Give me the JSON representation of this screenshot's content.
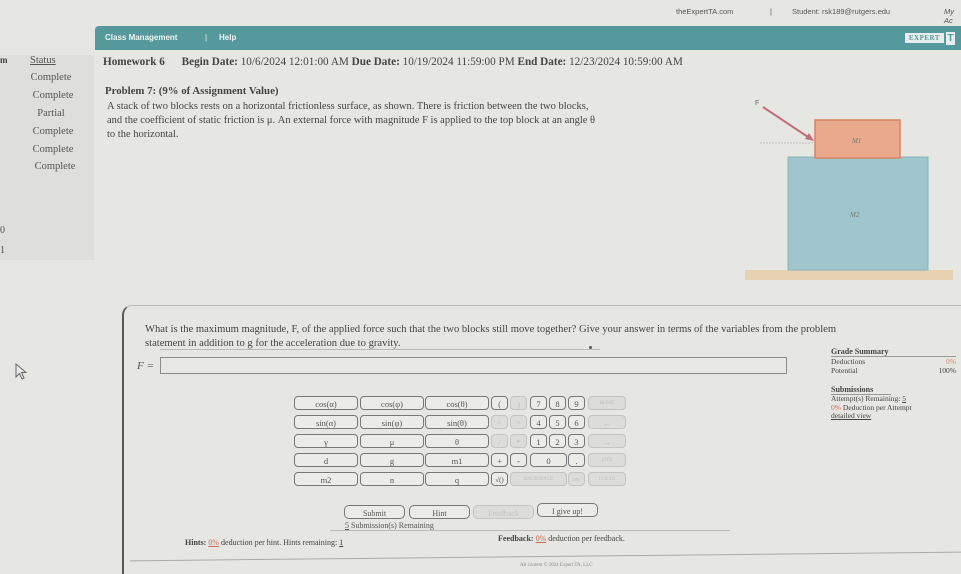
{
  "topbar": {
    "site": "theExpertTA.com",
    "separator": "|",
    "student": "Student: rsk189@rutgers.edu",
    "my_account": "My Ac"
  },
  "navbar": {
    "class_management": "Class Management",
    "separator": "|",
    "help": "Help",
    "logo_text": "EXPERT",
    "logo_mark": "TA",
    "color": "#56999c"
  },
  "sidebar": {
    "left_header": "m",
    "status_header": "Status",
    "statuses": [
      "Complete",
      "Complete",
      "Partial",
      "Complete",
      "Complete",
      "Complete"
    ],
    "row_numbers": [
      "0",
      "1"
    ]
  },
  "assignment": {
    "title": "Homework 6",
    "begin_label": "Begin Date:",
    "begin_value": "10/6/2024 12:01:00 AM",
    "due_label": "Due Date:",
    "due_value": "10/19/2024 11:59:00 PM",
    "end_label": "End Date:",
    "end_value": "12/23/2024 10:59:00 AM"
  },
  "problem": {
    "title": "Problem 7: (9% of Assignment Value)",
    "text_line1": "A stack of two blocks rests on a horizontal frictionless surface, as shown. There is friction between the two blocks,",
    "text_line2": "and the coefficient of static friction is μ. An external force with magnitude F is applied to the top block at an angle θ",
    "text_line3": "to the horizontal."
  },
  "figure": {
    "force_label": "F",
    "top_block_label": "M1",
    "bottom_block_label": "M2",
    "top_block_color": "#e9a98c",
    "bottom_block_color": "#9fc6cc",
    "floor_color": "#e6d2b0",
    "arrow_color": "#c66d7b"
  },
  "question": {
    "line1": "What is the maximum magnitude, F, of the applied force such that the two blocks still move together? Give your answer in terms of the variables from the problem",
    "line2": "statement in addition to g for the acceleration due to gravity.",
    "answer_label": "F =",
    "answer_value": ""
  },
  "grade_summary": {
    "title": "Grade Summary",
    "deductions_label": "Deductions",
    "deductions_value": "0%",
    "potential_label": "Potential",
    "potential_value": "100%",
    "submissions_title": "Submissions",
    "attempts_label": "Attempt(s) Remaining:",
    "attempts_value": "5",
    "deduction_per_attempt_value": "0%",
    "deduction_per_attempt_label": "Deduction per Attempt",
    "detailed_view": "detailed view"
  },
  "keypad": {
    "rows": [
      [
        "cos(α)",
        "cos(φ)",
        "cos(θ)",
        "(",
        ")",
        "7",
        "8",
        "9",
        "HOME"
      ],
      [
        "sin(α)",
        "sin(φ)",
        "sin(θ)",
        "^",
        "^",
        "4",
        "5",
        "6",
        "←"
      ],
      [
        "γ",
        "μ",
        "θ",
        "/",
        "*",
        "1",
        "2",
        "3",
        "→"
      ],
      [
        "d",
        "g",
        "m1",
        "+",
        "-",
        "0",
        ".",
        "END"
      ],
      [
        "m2",
        "n",
        "q",
        "√()",
        "BACKSPACE",
        "DEL",
        "CLEAR"
      ]
    ]
  },
  "actions": {
    "submit": "Submit",
    "hint": "Hint",
    "feedback": "Feedback",
    "give_up": "I give up!"
  },
  "submissions": {
    "count": "5",
    "label": "Submission(s) Remaining"
  },
  "hints": {
    "label": "Hints:",
    "percent": "0%",
    "text": "deduction per hint. Hints remaining:",
    "remaining": "1"
  },
  "feedback_info": {
    "label": "Feedback:",
    "percent": "0%",
    "text": "deduction per feedback."
  },
  "footer": {
    "text": "All content © 2024 Expert TA, LLC"
  }
}
